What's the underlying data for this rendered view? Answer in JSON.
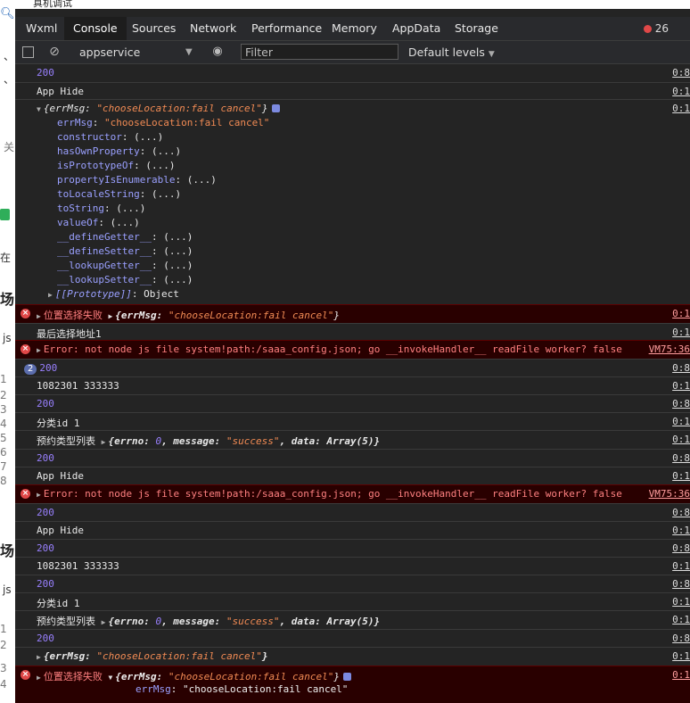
{
  "window": {
    "title": "真机调试"
  },
  "background_left": {
    "chars": [
      "、",
      "、",
      "关",
      "在",
      "场",
      "js",
      "1",
      "2",
      "3",
      "4",
      "5",
      "6",
      "7",
      "8",
      "场",
      "js",
      "1",
      "2",
      "3",
      "4"
    ]
  },
  "tabs": {
    "items": [
      "Wxml",
      "Console",
      "Sources",
      "Network",
      "Performance",
      "Memory",
      "AppData",
      "Storage"
    ],
    "active": "Console",
    "error_count": "26"
  },
  "toolbar": {
    "context": "appservice",
    "filter_placeholder": "Filter",
    "levels": "Default levels"
  },
  "log": {
    "r_200": "200",
    "src_08": "0:8",
    "src_01": "0:1",
    "app_hide": "App Hide",
    "obj_open": "{errMsg: ",
    "obj_str": "\"chooseLocation:fail cancel\"",
    "obj_close": "}",
    "errmsg_key": "errMsg",
    "errmsg_val": "\"chooseLocation:fail cancel\"",
    "props": [
      "constructor",
      "hasOwnProperty",
      "isPrototypeOf",
      "propertyIsEnumerable",
      "toLocaleString",
      "toString",
      "valueOf",
      "__defineGetter__",
      "__defineSetter__",
      "__lookupGetter__",
      "__lookupSetter__"
    ],
    "prop_val": ": (...)",
    "prototype_key": "[[Prototype]]",
    "prototype_val": ": Object",
    "location_fail": "位置选择失败",
    "last_address": "最后选择地址1",
    "error_msg": "Error: not node js file system!path:/saaa_config.json; go __invokeHandler__ readFile worker? false",
    "error_src": "VM75:36",
    "repeat_badge": "2",
    "id_pair": "1082301 333333",
    "category": "分类id 1",
    "booking_types": "预约类型列表",
    "success_obj_a": "{errno: ",
    "success_zero": "0",
    "success_obj_b": ", message: ",
    "success_str": "\"success\"",
    "success_obj_c": ", data: Array(5)}"
  }
}
